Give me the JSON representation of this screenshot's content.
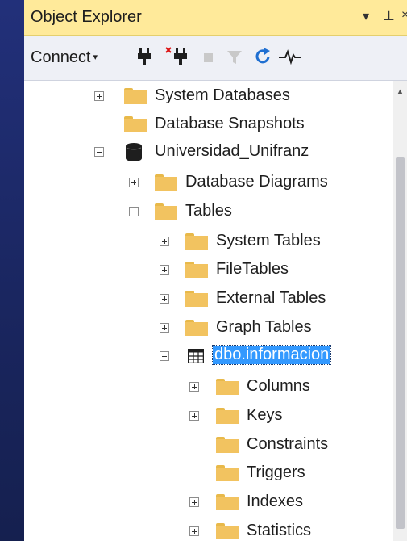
{
  "window": {
    "title": "Object Explorer",
    "controls": {
      "dropdown": "▾",
      "pin": "⊥",
      "close": "×"
    }
  },
  "toolbar": {
    "connect_label": "Connect",
    "connect_arrow": "▾",
    "tools": [
      {
        "icon": "connect-plug-icon",
        "glyph": "🔌"
      },
      {
        "icon": "disconnect-plug-icon",
        "glyph": "✖"
      },
      {
        "icon": "stop-icon",
        "glyph": "■"
      },
      {
        "icon": "filter-icon",
        "glyph": "▼"
      },
      {
        "icon": "refresh-icon",
        "glyph": "↻"
      },
      {
        "icon": "activity-monitor-icon",
        "glyph": "⩘"
      }
    ]
  },
  "tree": {
    "items": [
      {
        "label": "System Databases"
      },
      {
        "label": "Database Snapshots"
      },
      {
        "label": "Universidad_Unifranz"
      },
      {
        "label": "Database Diagrams"
      },
      {
        "label": "Tables"
      },
      {
        "label": "System Tables"
      },
      {
        "label": "FileTables"
      },
      {
        "label": "External Tables"
      },
      {
        "label": "Graph Tables"
      },
      {
        "label": "dbo.informacion"
      },
      {
        "label": "Columns"
      },
      {
        "label": "Keys"
      },
      {
        "label": "Constraints"
      },
      {
        "label": "Triggers"
      },
      {
        "label": "Indexes"
      },
      {
        "label": "Statistics"
      }
    ],
    "selected_index": 9
  },
  "colors": {
    "title_bar": "#ffea9a",
    "selection": "#3399ff",
    "folder": "#f2c360",
    "background": "#1b2a63"
  }
}
